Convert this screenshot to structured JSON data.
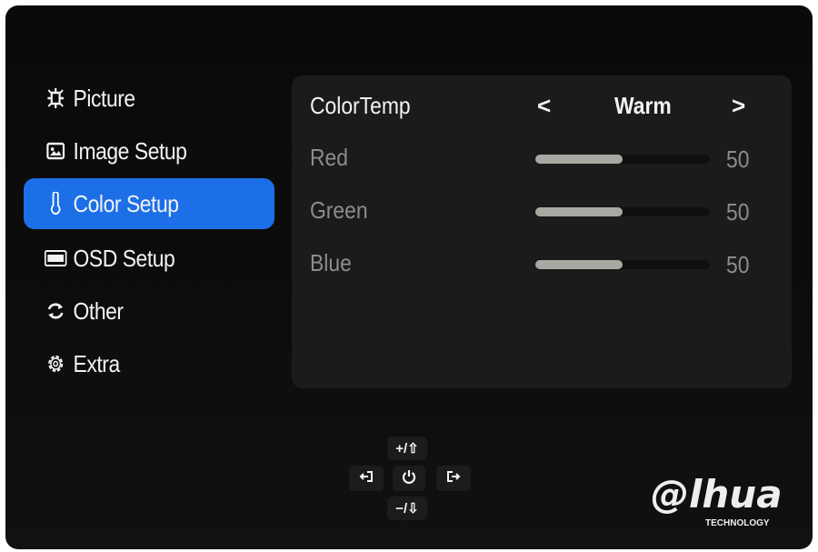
{
  "sidebar": {
    "items": [
      {
        "label": "Picture",
        "icon": "picture-icon",
        "active": false
      },
      {
        "label": "Image Setup",
        "icon": "image-setup-icon",
        "active": false
      },
      {
        "label": "Color Setup",
        "icon": "thermometer-icon",
        "active": true
      },
      {
        "label": "OSD Setup",
        "icon": "osd-icon",
        "active": false
      },
      {
        "label": "Other",
        "icon": "cycle-arrows-icon",
        "active": false
      },
      {
        "label": "Extra",
        "icon": "gear-icon",
        "active": false
      }
    ],
    "active_color": "#1d6fe8"
  },
  "panel": {
    "color_temp": {
      "label": "ColorTemp",
      "value": "Warm",
      "prev": "<",
      "next": ">"
    },
    "channels": [
      {
        "label": "Red",
        "value": "50",
        "level": 0.5
      },
      {
        "label": "Green",
        "value": "50",
        "level": 0.5
      },
      {
        "label": "Blue",
        "value": "50",
        "level": 0.5
      }
    ]
  },
  "keypad": {
    "up": "+/⇧",
    "left": "⟲",
    "power": "power-icon",
    "right": "⟳",
    "down": "−/⇩"
  },
  "logo": {
    "brand": "alhua",
    "tagline": "TECHNOLOGY"
  }
}
